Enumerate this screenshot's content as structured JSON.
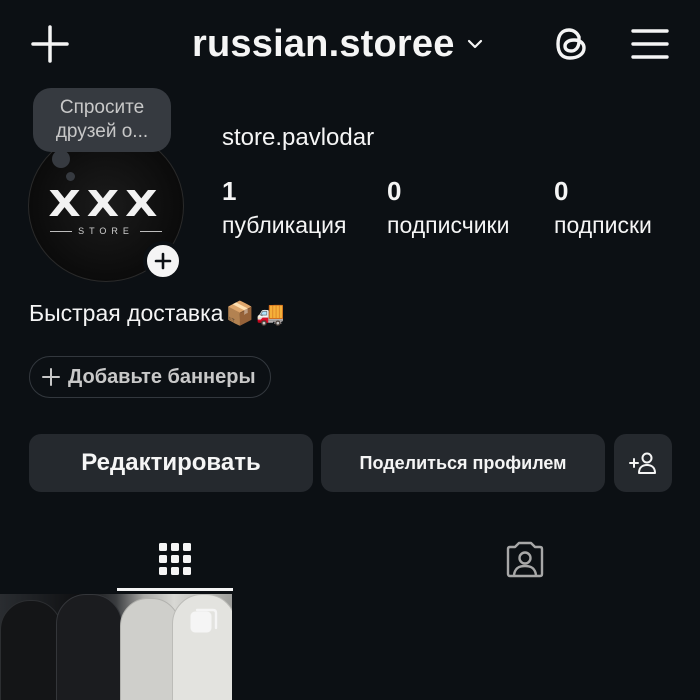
{
  "header": {
    "username": "russian.storee"
  },
  "profile": {
    "display_name": "store.pavlodar",
    "note": {
      "line1": "Спросите",
      "line2": "друзей о..."
    },
    "avatar_logo": {
      "main": "XXX",
      "sub": "STORE"
    },
    "stats": [
      {
        "value": "1",
        "label": "публикация"
      },
      {
        "value": "0",
        "label": "подписчики"
      },
      {
        "value": "0",
        "label": "подписки"
      }
    ],
    "bio": "Быстрая доставка",
    "bio_emoji": [
      "📦",
      "🚚"
    ]
  },
  "banner": {
    "label": "Добавьте баннеры"
  },
  "actions": {
    "edit_label": "Редактировать",
    "share_label": "Поделиться профилем"
  },
  "icons": {
    "create": "plus-icon",
    "dropdown": "chevron-down-icon",
    "threads": "threads-icon",
    "menu": "hamburger-menu-icon",
    "add_story": "plus-icon",
    "add_person": "add-person-icon",
    "grid_tab": "grid-icon",
    "tagged_tab": "tagged-person-icon",
    "multi_post": "carousel-icon"
  },
  "colors": {
    "background": "#0c1014",
    "button": "#25292e",
    "note_bubble": "#363a40",
    "text": "#f5f5f5"
  }
}
